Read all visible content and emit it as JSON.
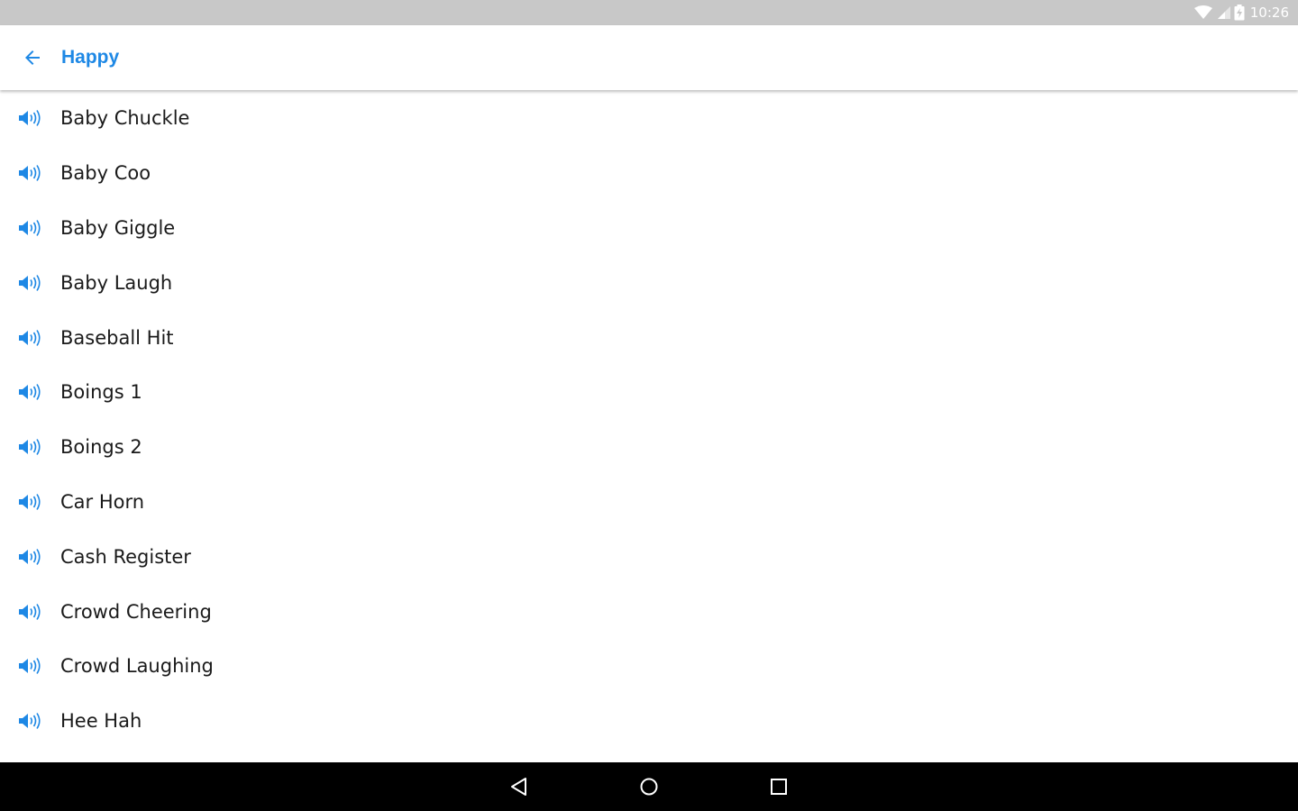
{
  "status_bar": {
    "time": "10:26",
    "icons": [
      "wifi-icon",
      "signal-icon",
      "battery-charging-icon"
    ]
  },
  "app_bar": {
    "back_icon": "arrow-back-icon",
    "title": "Happy"
  },
  "sounds": [
    {
      "label": "Baby Chuckle"
    },
    {
      "label": "Baby Coo"
    },
    {
      "label": "Baby Giggle"
    },
    {
      "label": "Baby Laugh"
    },
    {
      "label": "Baseball Hit"
    },
    {
      "label": "Boings 1"
    },
    {
      "label": "Boings 2"
    },
    {
      "label": "Car Horn"
    },
    {
      "label": "Cash Register"
    },
    {
      "label": "Crowd Cheering"
    },
    {
      "label": "Crowd Laughing"
    },
    {
      "label": "Hee Hah"
    }
  ],
  "nav_bar": {
    "buttons": [
      "back-nav-icon",
      "home-nav-icon",
      "recents-nav-icon"
    ]
  },
  "colors": {
    "accent": "#1e88e5",
    "status_bar": "#c8c8c8",
    "nav_bar": "#000000"
  }
}
